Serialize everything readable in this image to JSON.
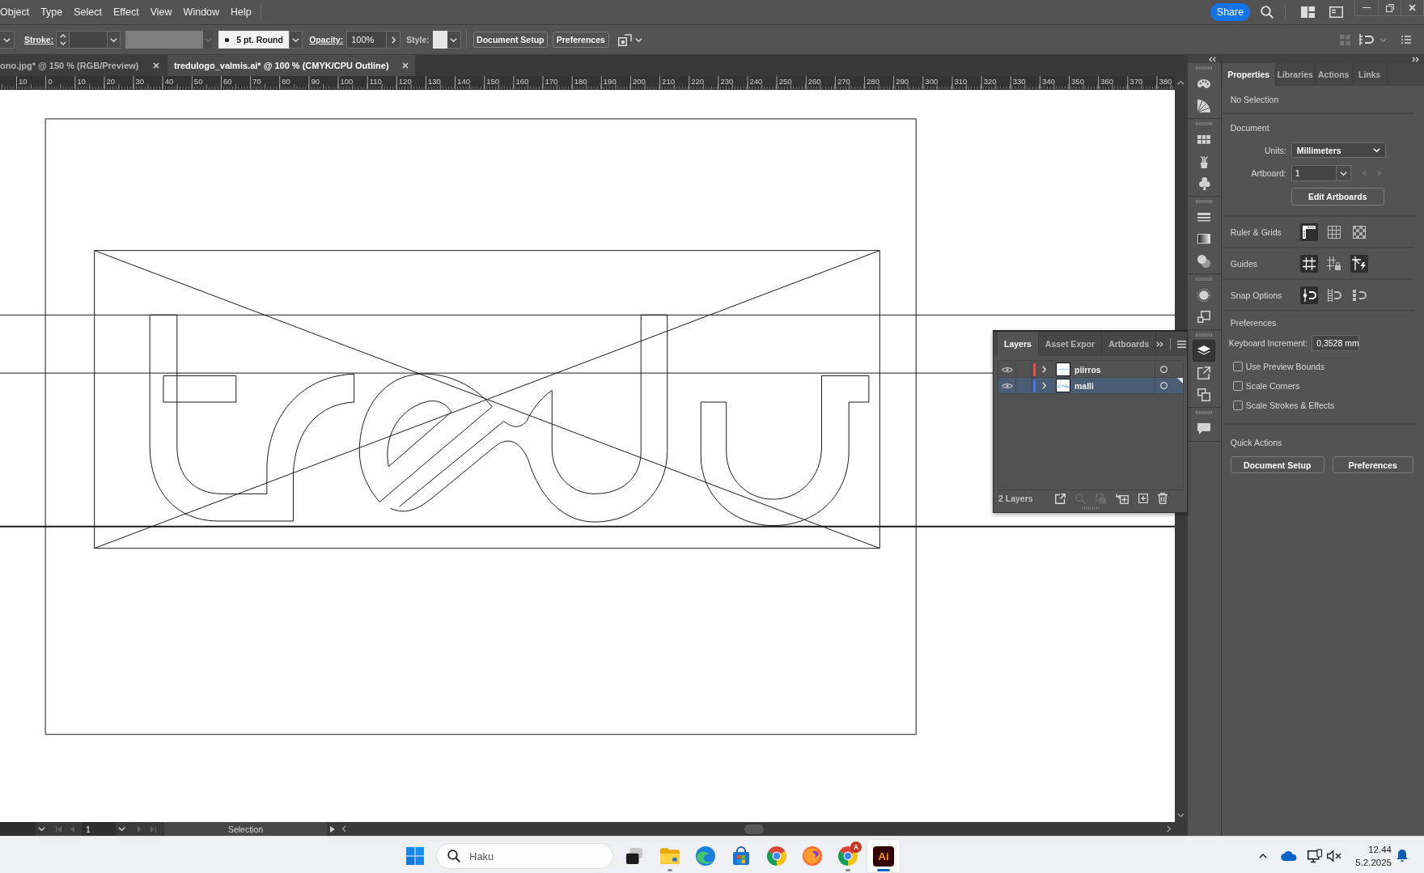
{
  "menu_bar": {
    "items": [
      "Object",
      "Type",
      "Select",
      "Effect",
      "View",
      "Window",
      "Help"
    ],
    "share": "Share"
  },
  "control_bar": {
    "stroke_label": "Stroke:",
    "brush": "5 pt. Round",
    "opacity_label": "Opacity:",
    "opacity": "100%",
    "style_label": "Style:",
    "buttons": [
      "Document Setup",
      "Preferences"
    ],
    "tools": [
      {
        "kind": "grid",
        "disabled": true
      },
      {
        "kind": "snap",
        "disabled": false
      },
      {
        "kind": "list",
        "disabled": false
      }
    ]
  },
  "document_tabs": [
    {
      "title": "ono.jpg* @ 150 % (RGB/Preview)",
      "selected": false
    },
    {
      "title": "tredulogo_valmis.ai* @ 100 % (CMYK/CPU Outline)",
      "selected": true
    }
  ],
  "ruler": {
    "labels": [
      "10",
      "0",
      "10",
      "20",
      "30",
      "40",
      "50",
      "60",
      "70",
      "80",
      "90",
      "100",
      "110",
      "120",
      "130",
      "140",
      "150",
      "160",
      "170",
      "180",
      "190",
      "200",
      "210",
      "220",
      "230",
      "240",
      "250",
      "260",
      "270",
      "280",
      "290",
      "300",
      "310",
      "320",
      "330",
      "340",
      "350",
      "360",
      "370",
      "380"
    ]
  },
  "layers_panel": {
    "tabs": [
      {
        "label": "Layers",
        "selected": true
      },
      {
        "label": "Asset Expor",
        "selected": false
      },
      {
        "label": "Artboards",
        "selected": false
      }
    ],
    "layers": [
      {
        "name": "piirros",
        "color": "#f04b4b",
        "visible": true,
        "expanded": false,
        "selected": false,
        "current": false
      },
      {
        "name": "malli",
        "color": "#4a73f5",
        "visible": true,
        "expanded": false,
        "selected": true,
        "current": true
      }
    ],
    "count": "2 Layers",
    "tools": [
      {
        "kind": "export",
        "disabled": false
      },
      {
        "kind": "locate",
        "disabled": true
      },
      {
        "kind": "clip",
        "disabled": true
      },
      {
        "kind": "sublayer",
        "disabled": false
      },
      {
        "kind": "new",
        "disabled": false
      },
      {
        "kind": "delete",
        "disabled": false
      }
    ]
  },
  "status_bar": {
    "nav": [
      {
        "kind": "first",
        "disabled": true
      },
      {
        "kind": "prev",
        "disabled": true
      },
      {
        "kind": "next",
        "disabled": true
      },
      {
        "kind": "last",
        "disabled": true
      }
    ],
    "artboard": "1",
    "tool": "Selection"
  },
  "tool_strip": {
    "groups": [
      {
        "items": [
          {
            "kind": "palette",
            "selected": false
          },
          {
            "kind": "color-guide",
            "selected": false
          }
        ]
      },
      {
        "items": [
          {
            "kind": "swatches",
            "selected": false
          },
          {
            "kind": "brushes",
            "selected": false
          },
          {
            "kind": "symbols",
            "selected": false
          }
        ]
      },
      {
        "items": [
          {
            "kind": "stroke",
            "selected": false
          },
          {
            "kind": "gradient",
            "selected": false
          },
          {
            "kind": "transparency",
            "selected": false
          }
        ]
      },
      {
        "items": [
          {
            "kind": "appearance",
            "selected": false
          },
          {
            "kind": "transform",
            "selected": false
          }
        ]
      },
      {
        "items": [
          {
            "kind": "layers",
            "selected": true
          },
          {
            "kind": "export",
            "selected": false
          },
          {
            "kind": "artboards",
            "selected": false
          }
        ]
      },
      {
        "items": [
          {
            "kind": "comments",
            "selected": false
          }
        ]
      }
    ]
  },
  "properties_panel": {
    "tabs": [
      {
        "label": "Properties",
        "selected": true
      },
      {
        "label": "Libraries",
        "selected": false
      },
      {
        "label": "Actions",
        "selected": false
      },
      {
        "label": "Links",
        "selected": false
      }
    ],
    "selection": "No Selection",
    "document": {
      "title": "Document",
      "units_label": "Units:",
      "units": "Millimeters",
      "artboard_label": "Artboard:",
      "artboard": "1",
      "artboard_nav": [
        {
          "kind": "prev",
          "disabled": true
        },
        {
          "kind": "next",
          "disabled": true
        }
      ],
      "edit_button": "Edit Artboards"
    },
    "toggle_rows": [
      {
        "label": "Ruler & Grids",
        "toggles": [
          {
            "kind": "ruler",
            "on": true
          },
          {
            "kind": "grid",
            "on": false
          },
          {
            "kind": "transparency-grid",
            "on": false
          }
        ]
      },
      {
        "label": "Guides",
        "toggles": [
          {
            "kind": "guides",
            "on": true
          },
          {
            "kind": "lock-guides",
            "on": false
          },
          {
            "kind": "smart-guides",
            "on": true
          }
        ]
      },
      {
        "label": "Snap Options",
        "toggles": [
          {
            "kind": "snap-point",
            "on": true
          },
          {
            "kind": "snap-grid",
            "on": false
          },
          {
            "kind": "snap-pixel",
            "on": false
          }
        ]
      }
    ],
    "preferences": {
      "title": "Preferences",
      "increment_label": "Keyboard Increment:",
      "increment": "0,3528 mm",
      "options": [
        {
          "label": "Use Preview Bounds",
          "checked": false
        },
        {
          "label": "Scale Corners",
          "checked": false
        },
        {
          "label": "Scale Strokes & Effects",
          "checked": false
        }
      ]
    },
    "quick_actions": {
      "title": "Quick Actions",
      "buttons": [
        "Document Setup",
        "Preferences"
      ]
    }
  },
  "taskbar": {
    "search": {
      "placeholder": "Haku"
    },
    "apps": [
      {
        "kind": "task-view",
        "running": false,
        "active": false
      },
      {
        "kind": "folder",
        "running": true,
        "active": false
      },
      {
        "kind": "swirl",
        "running": false,
        "active": false
      },
      {
        "kind": "bag",
        "running": false,
        "active": false
      },
      {
        "kind": "ring",
        "running": false,
        "active": false
      },
      {
        "kind": "fox",
        "running": false,
        "active": false
      },
      {
        "kind": "ring",
        "running": true,
        "active": false,
        "badge": "A"
      },
      {
        "kind": "tile",
        "running": true,
        "active": true,
        "label": "Ai"
      }
    ],
    "time": "12.44",
    "date": "5.2.2025"
  }
}
